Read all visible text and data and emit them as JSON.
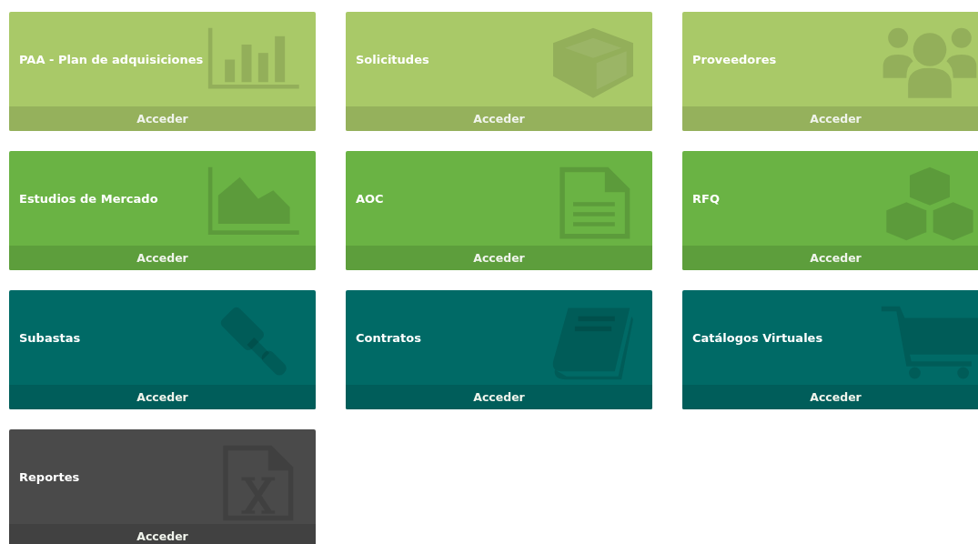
{
  "tiles": [
    {
      "title": "PAA - Plan de adquisiciones",
      "action": "Acceder",
      "color": "#a9c968"
    },
    {
      "title": "Solicitudes",
      "action": "Acceder",
      "color": "#a9c968"
    },
    {
      "title": "Proveedores",
      "action": "Acceder",
      "color": "#a9c968"
    },
    {
      "title": "Estudios de Mercado",
      "action": "Acceder",
      "color": "#6ab344"
    },
    {
      "title": "AOC",
      "action": "Acceder",
      "color": "#6ab344"
    },
    {
      "title": "RFQ",
      "action": "Acceder",
      "color": "#6ab344"
    },
    {
      "title": "Subastas",
      "action": "Acceder",
      "color": "#006a66"
    },
    {
      "title": "Contratos",
      "action": "Acceder",
      "color": "#006a66"
    },
    {
      "title": "Catálogos Virtuales",
      "action": "Acceder",
      "color": "#006a66"
    },
    {
      "title": "Reportes",
      "action": "Acceder",
      "color": "#4a4a4a"
    }
  ]
}
